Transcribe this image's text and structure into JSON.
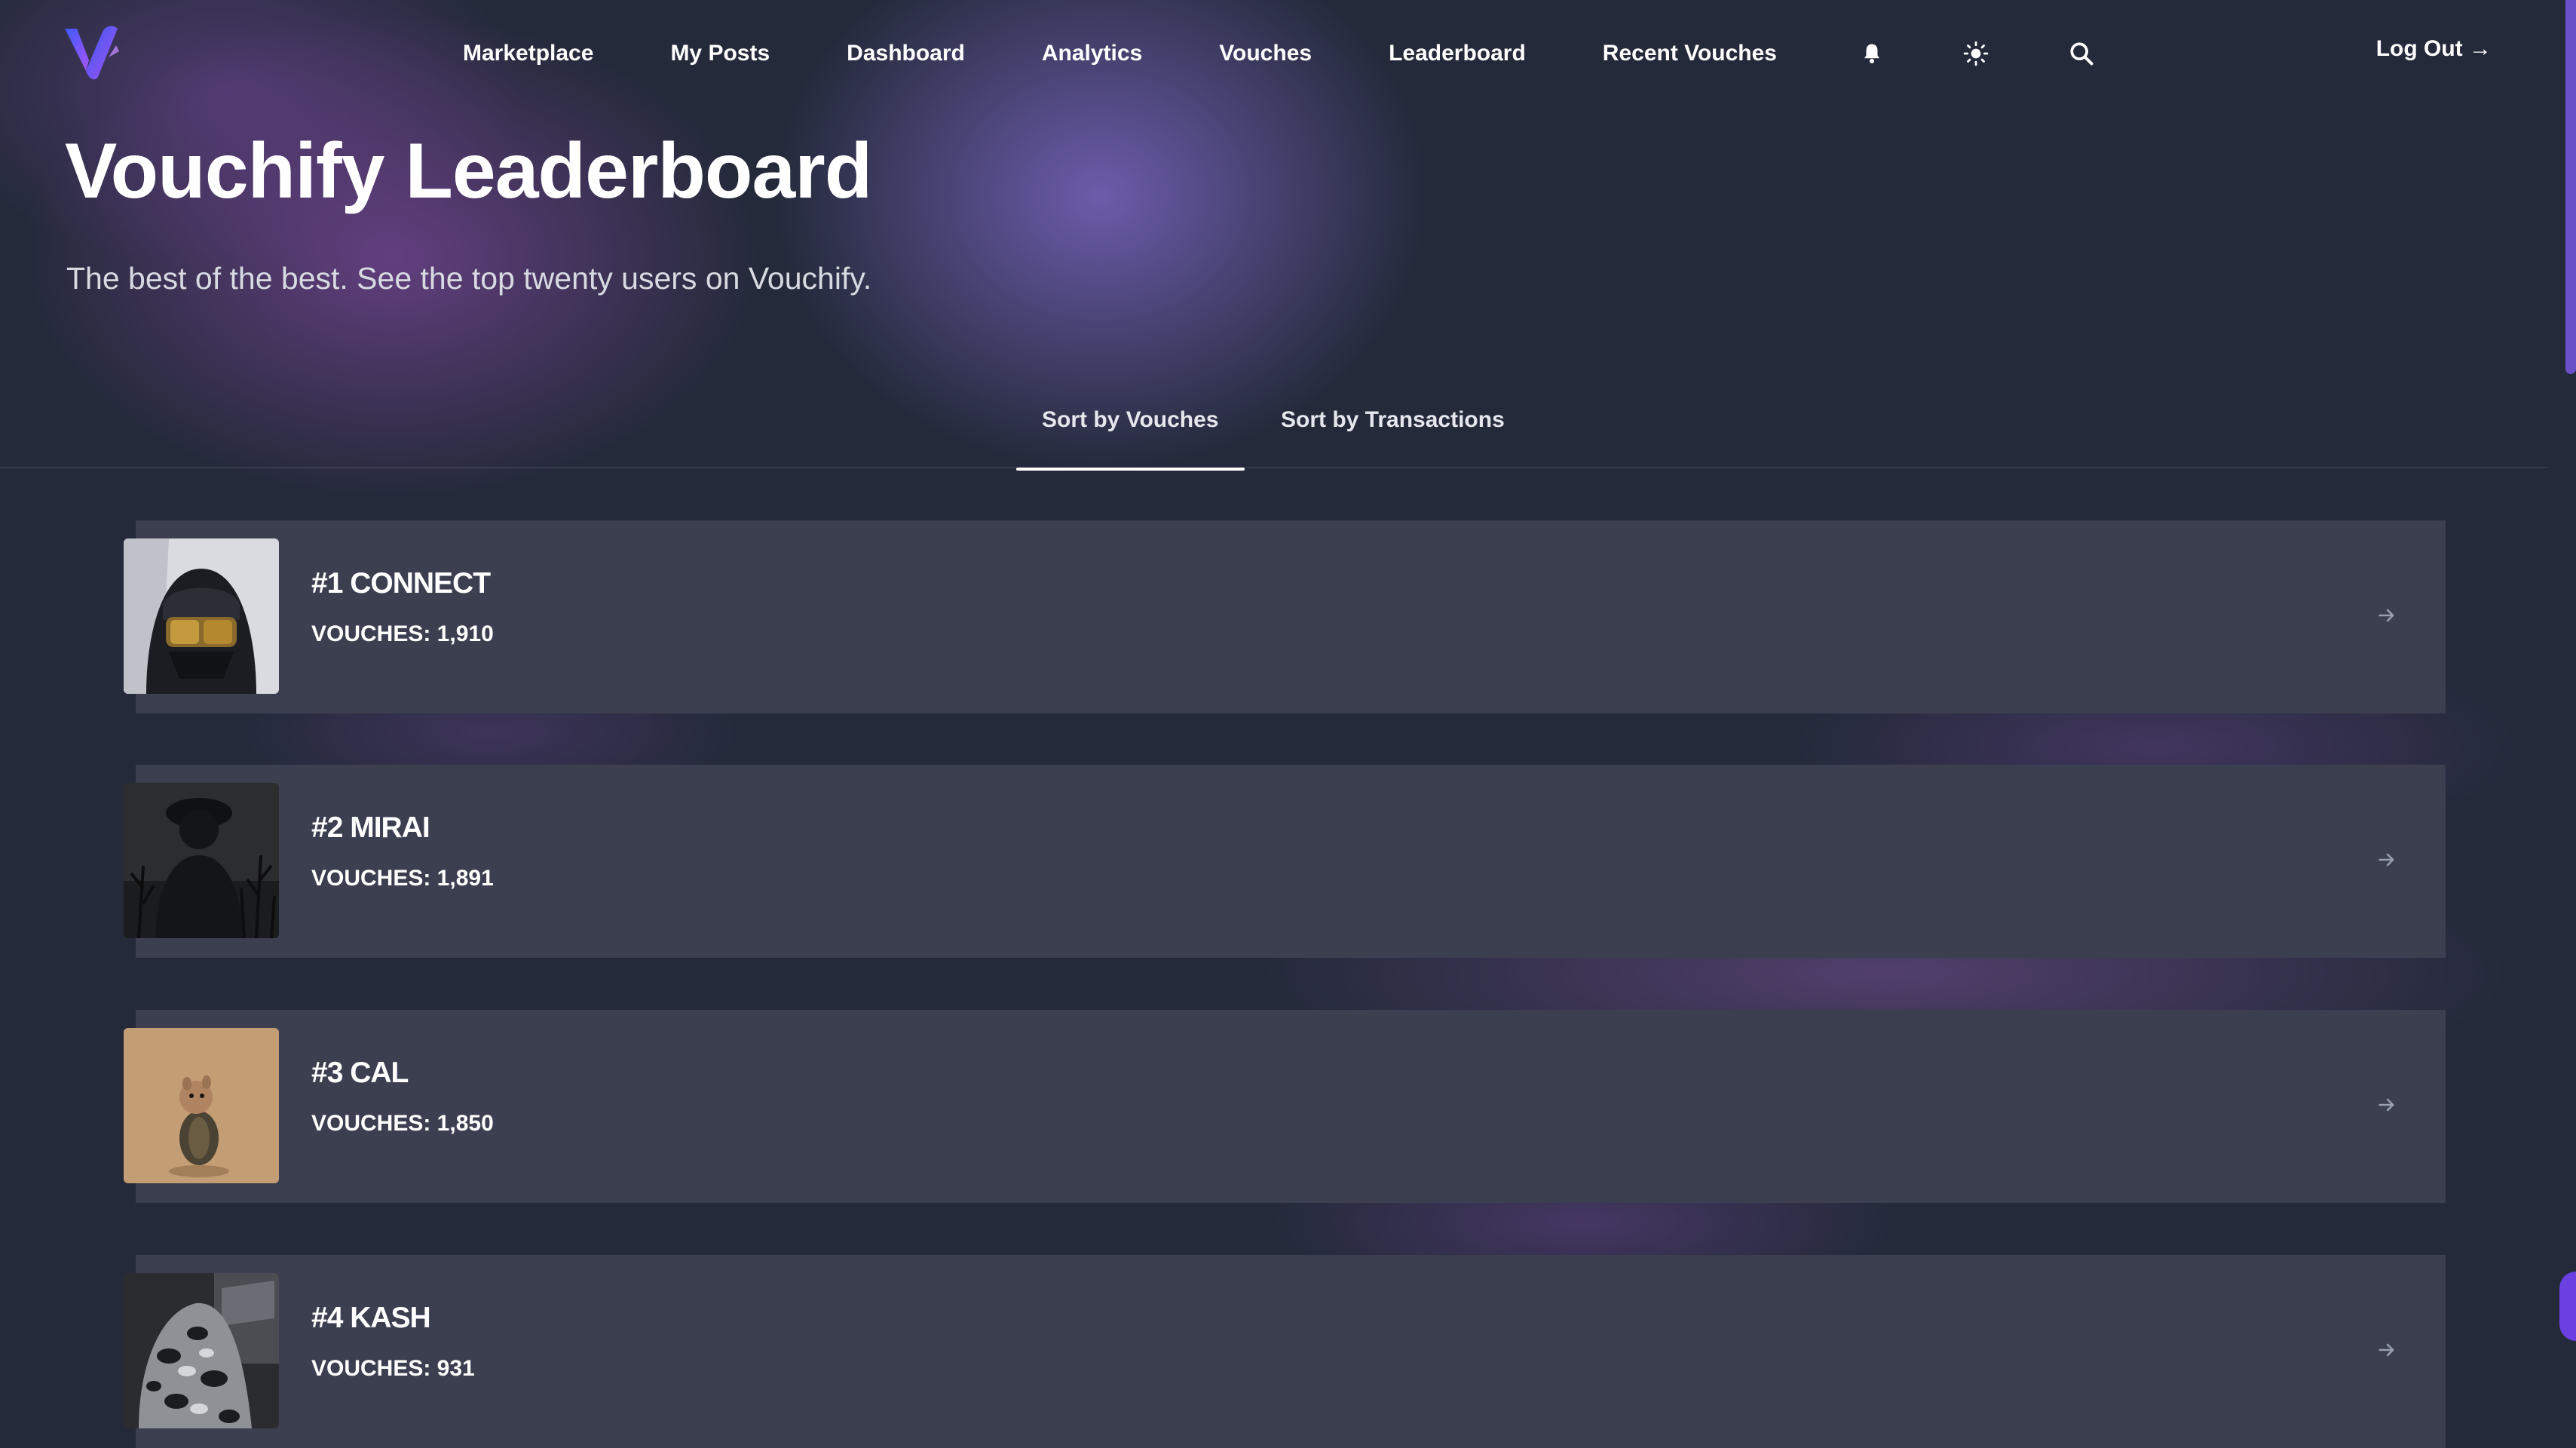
{
  "nav": {
    "links": [
      "Marketplace",
      "My Posts",
      "Dashboard",
      "Analytics",
      "Vouches",
      "Leaderboard",
      "Recent Vouches"
    ],
    "icons": [
      "bell-icon",
      "sun-icon",
      "search-icon"
    ],
    "logout_label": "Log Out →"
  },
  "header": {
    "title": "Vouchify Leaderboard",
    "subtitle": "The best of the best. See the top twenty users on Vouchify."
  },
  "tabs": [
    {
      "label": "Sort by Vouches",
      "active": true
    },
    {
      "label": "Sort by Transactions",
      "active": false
    }
  ],
  "leaderboard": [
    {
      "rank_name": "#1 CONNECT",
      "vouches": "VOUCHES: 1,910"
    },
    {
      "rank_name": "#2 MIRAI",
      "vouches": "VOUCHES: 1,891"
    },
    {
      "rank_name": "#3 CAL",
      "vouches": "VOUCHES: 1,850"
    },
    {
      "rank_name": "#4 KASH",
      "vouches": "VOUCHES: 931"
    }
  ],
  "colors": {
    "background": "#242a3a",
    "card": "#3b3f50",
    "accent": "#6b3fe0",
    "logo_gradient": [
      "#3d5afe",
      "#a855f7"
    ]
  }
}
